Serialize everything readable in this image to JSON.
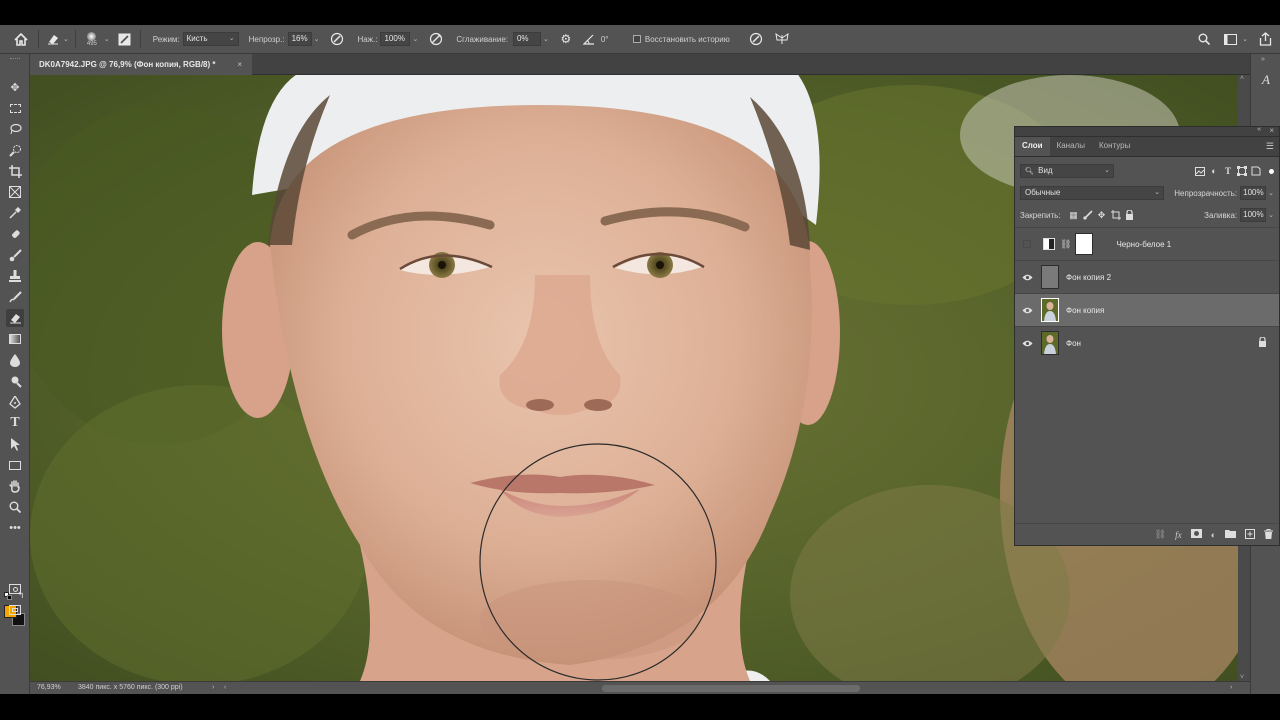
{
  "options_bar": {
    "brush_size": "495",
    "mode_label": "Режим:",
    "mode_value": "Кисть",
    "opacity_label": "Непрозр.:",
    "opacity_value": "16%",
    "pressure_label": "Наж.:",
    "pressure_value": "100%",
    "smoothing_label": "Сглаживание:",
    "smoothing_value": "0%",
    "angle_value": "0°",
    "restore_history_label": "Восстановить историю"
  },
  "document_tab": {
    "title": "DK0A7942.JPG @ 76,9% (Фон копия, RGB/8) *",
    "close": "×"
  },
  "status_bar": {
    "zoom": "76,93%",
    "dimensions": "3840 пикс. x 5760 пикс. (300 ppi)"
  },
  "layers_panel": {
    "tabs": [
      "Слои",
      "Каналы",
      "Контуры"
    ],
    "filter_value": "Вид",
    "blend_mode": "Обычные",
    "opacity_label": "Непрозрачность:",
    "opacity_value": "100%",
    "lock_label": "Закрепить:",
    "fill_label": "Заливка:",
    "fill_value": "100%",
    "layers": [
      {
        "name": "Черно-белое 1",
        "visible": false,
        "selected": false
      },
      {
        "name": "Фон копия 2",
        "visible": true,
        "selected": false
      },
      {
        "name": "Фон копия",
        "visible": true,
        "selected": true
      },
      {
        "name": "Фон",
        "visible": true,
        "selected": false,
        "locked": true
      }
    ]
  },
  "colors": {
    "foreground": "#f5a500",
    "background": "#111111",
    "ui_panel": "#535353",
    "ui_dark": "#424242",
    "selected_layer": "#6b6b6b"
  }
}
